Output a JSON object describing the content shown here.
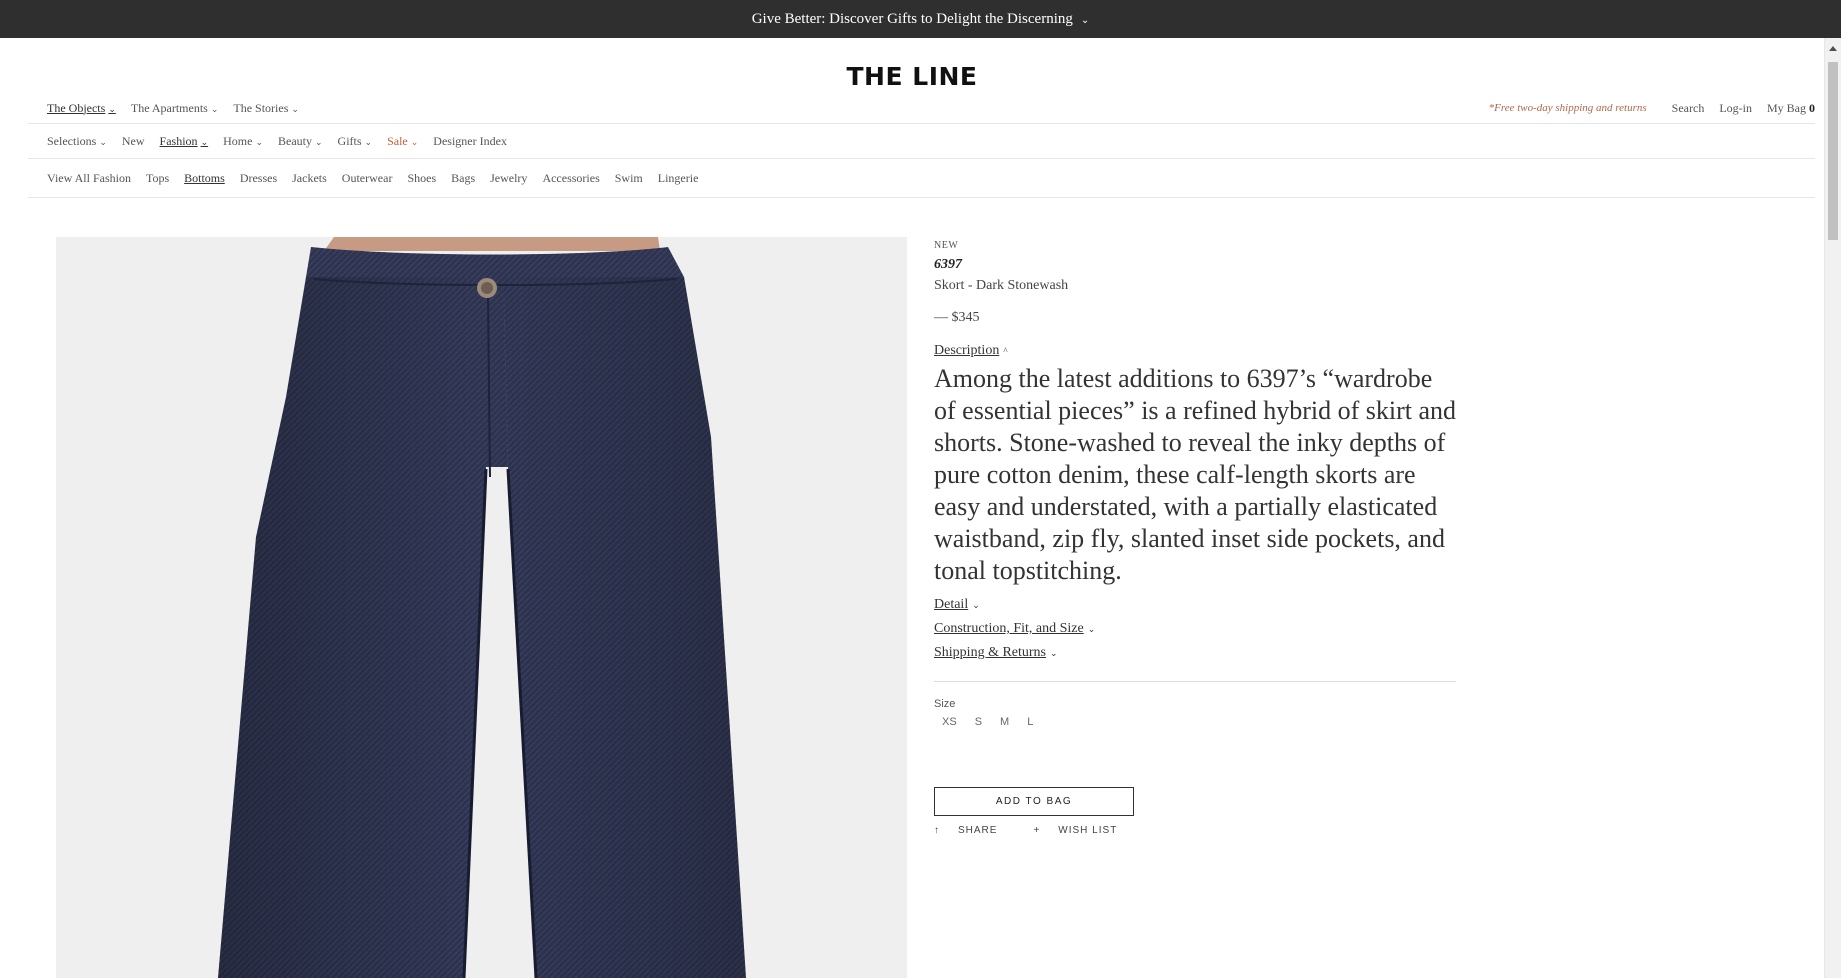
{
  "promo": {
    "text": "Give Better: Discover Gifts to Delight the Discerning",
    "chevron": "⌄"
  },
  "logo": "THE LINE",
  "top_nav": {
    "left": [
      {
        "label": "The Objects",
        "active": true
      },
      {
        "label": "The Apartments",
        "active": false
      },
      {
        "label": "The Stories",
        "active": false
      }
    ],
    "shipping_note": "*Free two-day shipping and returns",
    "search": "Search",
    "login": "Log-in",
    "bag_label": "My Bag",
    "bag_count": "0"
  },
  "category_nav": [
    {
      "label": "Selections",
      "caret": true
    },
    {
      "label": "New",
      "caret": false
    },
    {
      "label": "Fashion",
      "caret": true,
      "active": true
    },
    {
      "label": "Home",
      "caret": true
    },
    {
      "label": "Beauty",
      "caret": true
    },
    {
      "label": "Gifts",
      "caret": true
    },
    {
      "label": "Sale",
      "caret": true,
      "sale": true
    },
    {
      "label": "Designer Index",
      "caret": false
    }
  ],
  "sub_nav": [
    {
      "label": "View All Fashion"
    },
    {
      "label": "Tops"
    },
    {
      "label": "Bottoms",
      "active": true
    },
    {
      "label": "Dresses"
    },
    {
      "label": "Jackets"
    },
    {
      "label": "Outerwear"
    },
    {
      "label": "Shoes"
    },
    {
      "label": "Bags"
    },
    {
      "label": "Jewelry"
    },
    {
      "label": "Accessories"
    },
    {
      "label": "Swim"
    },
    {
      "label": "Lingerie"
    }
  ],
  "product": {
    "badge": "NEW",
    "designer": "6397",
    "name": "Skort - Dark Stonewash",
    "price": "— $345",
    "description_label": "Description",
    "description": "Among the latest additions to 6397’s “wardrobe of essential pieces” is a refined hybrid of skirt and shorts. Stone-washed to reveal the inky depths of pure cotton denim, these calf-length skorts are easy and understated, with a partially elasticated waistband, zip fly, slanted inset side pockets, and tonal topstitching.",
    "accordions": [
      "Detail",
      "Construction, Fit, and Size",
      "Shipping & Returns"
    ],
    "size_label": "Size",
    "sizes": [
      "XS",
      "S",
      "M",
      "L"
    ],
    "add_to_bag": "ADD TO BAG",
    "share": "SHARE",
    "wish_list": "WISH LIST",
    "share_icon": "↑",
    "wish_icon": "+"
  },
  "colors": {
    "promo_bg": "#2f2f2f",
    "sale": "#c0603a",
    "shipping_note": "#b06a4a",
    "denim": "#2e3450",
    "image_bg": "#efefef"
  }
}
